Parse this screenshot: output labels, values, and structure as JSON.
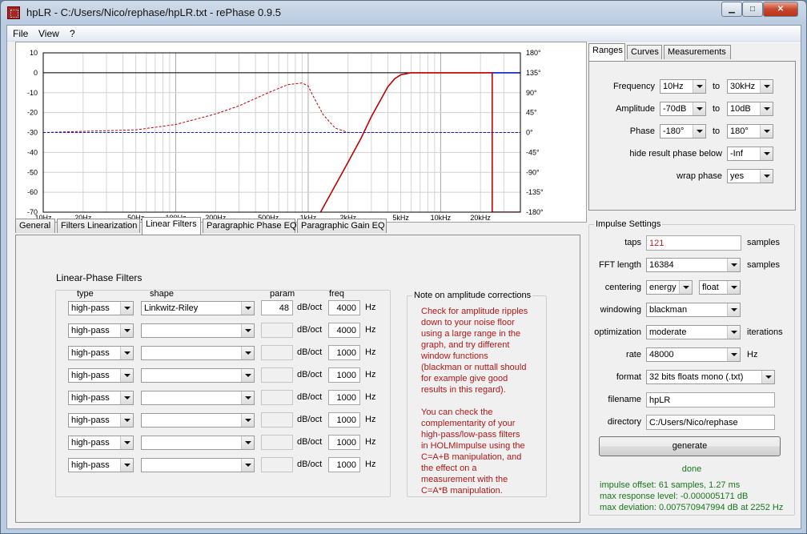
{
  "window": {
    "title": "hpLR  -  C:/Users/Nico/rephase/hpLR.txt  -  rePhase 0.9.5",
    "min_glyph": "▁",
    "max_glyph": "□",
    "close_glyph": "✕"
  },
  "menu": [
    "File",
    "View",
    "?"
  ],
  "chart_data": {
    "type": "line",
    "x_scale": "log",
    "xlim": [
      10,
      40000
    ],
    "ylim_left": [
      -70,
      10
    ],
    "ylim_right": [
      -180,
      180
    ],
    "grid": true,
    "x_ticks": [
      "10Hz",
      "20Hz",
      "50Hz",
      "100Hz",
      "200Hz",
      "500Hz",
      "1kHz",
      "2kHz",
      "5kHz",
      "10kHz",
      "20kHz"
    ],
    "y_left_ticks": [
      "10",
      "0",
      "-10",
      "-20",
      "-30",
      "-40",
      "-50",
      "-60",
      "-70"
    ],
    "y_right_ticks": [
      "180°",
      "135°",
      "90°",
      "45°",
      "0°",
      "-45°",
      "-90°",
      "-135°",
      "-180°"
    ],
    "series": [
      {
        "color": "#c00000",
        "style": "solid",
        "axis": "left",
        "x": [
          1240,
          1500,
          2000,
          2500,
          3000,
          3500,
          4000,
          4500,
          5000,
          6000,
          8000,
          10000,
          20000,
          24500,
          24500,
          40000
        ],
        "y": [
          -70,
          -60,
          -45,
          -33,
          -22,
          -14,
          -7,
          -3,
          -1,
          0,
          0,
          0,
          0,
          0,
          -70,
          -70
        ]
      },
      {
        "color": "#c00000",
        "style": "dashed",
        "axis": "right",
        "x": [
          10,
          50,
          100,
          200,
          300,
          500,
          700,
          900,
          1000,
          1100,
          1300,
          1600,
          2000,
          2500,
          4000,
          40000
        ],
        "y": [
          0,
          6,
          18,
          42,
          60,
          90,
          108,
          112,
          105,
          80,
          40,
          10,
          0,
          0,
          0,
          0
        ]
      },
      {
        "color": "#1020c0",
        "style": "dashed",
        "axis": "right",
        "x": [
          10,
          40000
        ],
        "y": [
          0,
          0
        ]
      },
      {
        "color": "#1020c0",
        "style": "solid",
        "axis": "left",
        "x": [
          24500,
          40000
        ],
        "y": [
          0,
          0
        ]
      }
    ]
  },
  "range_tabs": [
    "Ranges",
    "Curves",
    "Measurements"
  ],
  "ranges": {
    "frequency": {
      "label": "Frequency",
      "from": "10Hz",
      "to": "30kHz"
    },
    "amplitude": {
      "label": "Amplitude",
      "from": "-70dB",
      "to": "10dB"
    },
    "phase": {
      "label": "Phase",
      "from": "-180°",
      "to": "180°"
    },
    "to_label": "to",
    "hide_phase": {
      "label": "hide result phase below",
      "value": "-Inf"
    },
    "wrap_phase": {
      "label": "wrap phase",
      "value": "yes"
    }
  },
  "main_tabs": [
    "General",
    "Filters Linearization",
    "Linear Filters",
    "Paragraphic Phase EQ",
    "Paragraphic Gain EQ"
  ],
  "linear_filters": {
    "title": "Linear-Phase Filters",
    "col_type": "type",
    "col_shape": "shape",
    "col_param": "param",
    "col_freq": "freq",
    "param_unit": "dB/oct",
    "freq_unit": "Hz",
    "rows": [
      {
        "type": "high-pass",
        "shape": "Linkwitz-Riley",
        "param": "48",
        "freq": "4000"
      },
      {
        "type": "high-pass",
        "shape": "",
        "param": "",
        "freq": "4000"
      },
      {
        "type": "high-pass",
        "shape": "",
        "param": "",
        "freq": "1000"
      },
      {
        "type": "high-pass",
        "shape": "",
        "param": "",
        "freq": "1000"
      },
      {
        "type": "high-pass",
        "shape": "",
        "param": "",
        "freq": "1000"
      },
      {
        "type": "high-pass",
        "shape": "",
        "param": "",
        "freq": "1000"
      },
      {
        "type": "high-pass",
        "shape": "",
        "param": "",
        "freq": "1000"
      },
      {
        "type": "high-pass",
        "shape": "",
        "param": "",
        "freq": "1000"
      }
    ]
  },
  "note": {
    "title": "Note on amplitude corrections",
    "lines": [
      "Check for amplitude ripples",
      "down to your noise floor",
      "using a large range in the",
      "graph, and try different",
      "window functions",
      "(blackman or nuttall should",
      "for example give good",
      "results in this regard).",
      "",
      "You can check the",
      "complementarity of your",
      "high-pass/low-pass filters",
      "in HOLMImpulse using the",
      "C=A+B manipulation, and",
      "the effect on a",
      "measurement with the",
      "C=A*B manipulation."
    ]
  },
  "impulse": {
    "title": "Impulse Settings",
    "taps": {
      "label": "taps",
      "value": "121",
      "unit": "samples"
    },
    "fft": {
      "label": "FFT length",
      "value": "16384",
      "unit": "samples"
    },
    "centering": {
      "label": "centering",
      "value": "energy",
      "value2": "float"
    },
    "windowing": {
      "label": "windowing",
      "value": "blackman"
    },
    "optimization": {
      "label": "optimization",
      "value": "moderate",
      "unit": "iterations"
    },
    "rate": {
      "label": "rate",
      "value": "48000",
      "unit": "Hz"
    },
    "format": {
      "label": "format",
      "value": "32 bits floats mono (.txt)"
    },
    "filename": {
      "label": "filename",
      "value": "hpLR"
    },
    "directory": {
      "label": "directory",
      "value": "C:/Users/Nico/rephase"
    },
    "generate": "generate",
    "status": "done",
    "results": [
      "impulse offset: 61 samples, 1.27 ms",
      "max response level: -0.000005171 dB",
      "max deviation: 0.007570947994 dB at 2252 Hz"
    ]
  }
}
